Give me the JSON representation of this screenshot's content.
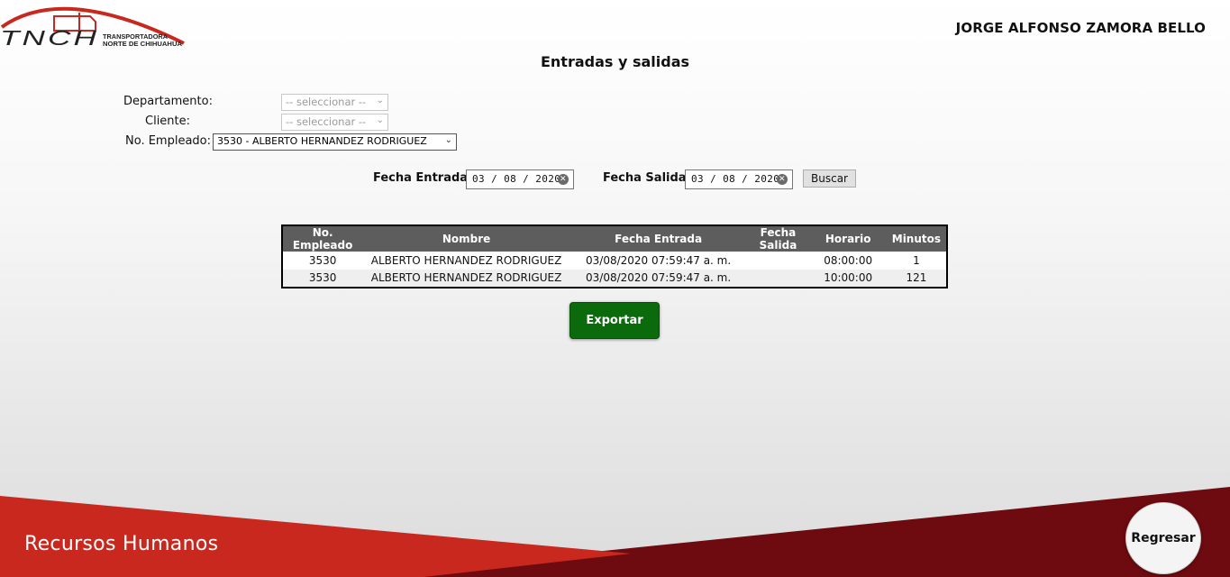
{
  "header": {
    "logo_wordmark": "TNCH",
    "logo_subtitle_line1": "TRANSPORTADORA",
    "logo_subtitle_line2": "NORTE DE CHIHUAHUA",
    "user_name": "JORGE ALFONSO ZAMORA BELLO"
  },
  "page": {
    "title": "Entradas y salidas"
  },
  "filters": {
    "departamento_label": "Departamento:",
    "departamento_value": "-- seleccionar --",
    "cliente_label": "Cliente:",
    "cliente_value": "-- seleccionar --",
    "empleado_label": "No. Empleado:",
    "empleado_value": "3530 - ALBERTO HERNANDEZ RODRIGUEZ",
    "chevron_icon": "chevron-down-icon"
  },
  "dates": {
    "entrada_label": "Fecha Entrada:",
    "entrada_value": "03 / 08 / 2020",
    "salida_label": "Fecha Salida:",
    "salida_value": "03 / 08 / 2020",
    "clear_icon": "clear-icon",
    "search_button": "Buscar"
  },
  "table": {
    "headers": [
      "No. Empleado",
      "Nombre",
      "Fecha Entrada",
      "Fecha Salida",
      "Horario",
      "Minutos"
    ],
    "rows": [
      [
        "3530",
        "ALBERTO HERNANDEZ RODRIGUEZ",
        "03/08/2020 07:59:47 a. m.",
        "",
        "08:00:00",
        "1"
      ],
      [
        "3530",
        "ALBERTO HERNANDEZ RODRIGUEZ",
        "03/08/2020 07:59:47 a. m.",
        "",
        "10:00:00",
        "121"
      ]
    ]
  },
  "actions": {
    "export_button": "Exportar"
  },
  "footer": {
    "section_title": "Recursos Humanos",
    "back_button": "Regresar"
  },
  "colors": {
    "brand_red": "#c9281f",
    "dark_red": "#6e0b10",
    "export_green": "#0b6a0b",
    "table_header": "#5d5d5d"
  }
}
